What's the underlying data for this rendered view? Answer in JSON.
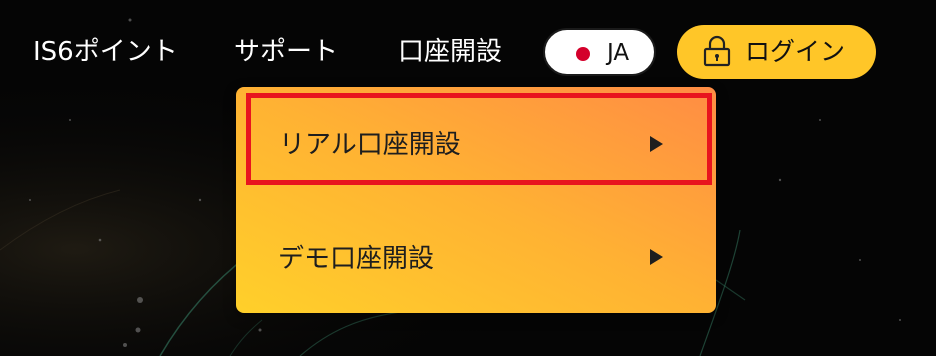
{
  "nav": {
    "items": [
      {
        "label": "IS6ポイント"
      },
      {
        "label": "サポート"
      },
      {
        "label": "口座開設"
      }
    ]
  },
  "language": {
    "label": "JA",
    "flag_color": "#d4002b"
  },
  "login": {
    "label": "ログイン",
    "icon": "lock-icon",
    "color": "#ffc628"
  },
  "dropdown": {
    "items": [
      {
        "label": "リアル口座開設",
        "icon": "chevron-right-icon",
        "highlighted": true
      },
      {
        "label": "デモ口座開設",
        "icon": "chevron-right-icon",
        "highlighted": false
      }
    ],
    "gradient_start": "#ffd02a",
    "gradient_end": "#ff8c44"
  },
  "highlight_color": "#e8141e"
}
